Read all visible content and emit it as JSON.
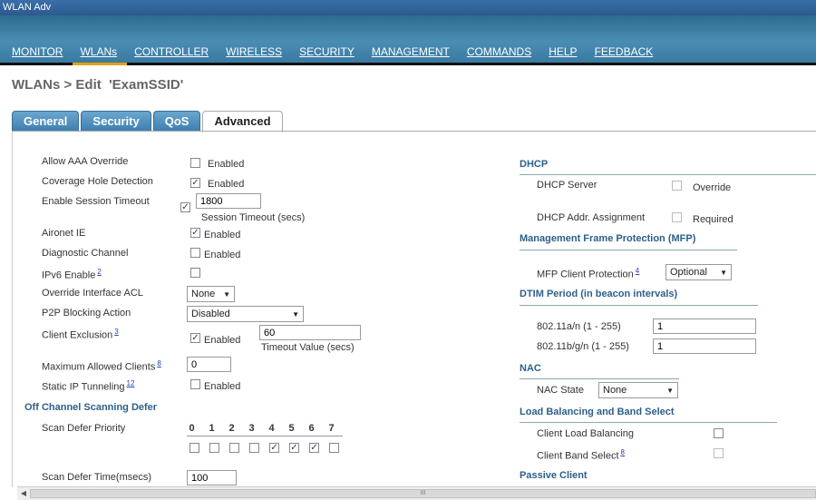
{
  "window": {
    "title": "WLAN Adv"
  },
  "menu": [
    {
      "label": "MONITOR"
    },
    {
      "label": "WLANs"
    },
    {
      "label": "CONTROLLER"
    },
    {
      "label": "WIRELESS"
    },
    {
      "label": "SECURITY"
    },
    {
      "label": "MANAGEMENT"
    },
    {
      "label": "COMMANDS"
    },
    {
      "label": "HELP"
    },
    {
      "label": "FEEDBACK"
    }
  ],
  "page": {
    "title": "WLANs > Edit  'ExamSSID'"
  },
  "tabs": [
    {
      "label": "General"
    },
    {
      "label": "Security"
    },
    {
      "label": "QoS"
    },
    {
      "label": "Advanced"
    }
  ],
  "left": {
    "allow_aaa": {
      "label": "Allow AAA Override",
      "cb": "Enabled",
      "checked": false
    },
    "coverage_hole": {
      "label": "Coverage Hole Detection",
      "cb": "Enabled",
      "checked": true
    },
    "session_timeout": {
      "label": "Enable Session Timeout",
      "checked": true,
      "value": "1800",
      "caption": "Session Timeout (secs)"
    },
    "aironet_ie": {
      "label": "Aironet IE",
      "cb": "Enabled",
      "checked": true
    },
    "diag_channel": {
      "label": "Diagnostic Channel",
      "cb": "Enabled",
      "checked": false
    },
    "ipv6": {
      "label": "IPv6 Enable",
      "sup": "2",
      "checked": false
    },
    "override_acl": {
      "label": "Override Interface ACL",
      "value": "None"
    },
    "p2p": {
      "label": "P2P Blocking Action",
      "value": "Disabled"
    },
    "client_exclusion": {
      "label": "Client Exclusion",
      "sup": "3",
      "cb": "Enabled",
      "checked": true,
      "value": "60",
      "caption": "Timeout Value (secs)"
    },
    "max_clients": {
      "label": "Maximum Allowed Clients",
      "sup": "8",
      "value": "0"
    },
    "static_ip": {
      "label": "Static IP Tunneling",
      "sup": "12",
      "cb": "Enabled",
      "checked": false
    },
    "off_channel": {
      "title": "Off Channel Scanning Defer"
    },
    "scan_priority": {
      "label": "Scan Defer Priority",
      "numbers": [
        "0",
        "1",
        "2",
        "3",
        "4",
        "5",
        "6",
        "7"
      ],
      "checked": [
        false,
        false,
        false,
        false,
        true,
        true,
        true,
        false
      ]
    },
    "scan_time": {
      "label": "Scan Defer Time(msecs)",
      "value": "100"
    }
  },
  "right": {
    "dhcp": {
      "title": "DHCP"
    },
    "dhcp_server": {
      "label": "DHCP Server",
      "cb": "Override",
      "checked": false
    },
    "dhcp_assign": {
      "label": "DHCP Addr. Assignment",
      "cb": "Required",
      "checked": false
    },
    "mfp": {
      "title": "Management Frame Protection (MFP)"
    },
    "mfp_client": {
      "label": "MFP Client Protection",
      "sup": "4",
      "value": "Optional"
    },
    "dtim": {
      "title": "DTIM Period (in beacon intervals)"
    },
    "dtim_a": {
      "label": "802.11a/n (1 - 255)",
      "value": "1"
    },
    "dtim_b": {
      "label": "802.11b/g/n (1 - 255)",
      "value": "1"
    },
    "nac": {
      "title": "NAC"
    },
    "nac_state": {
      "label": "NAC State",
      "value": "None"
    },
    "lb": {
      "title": "Load Balancing and Band Select"
    },
    "client_lb": {
      "label": "Client Load Balancing",
      "checked": false
    },
    "client_bs": {
      "label": "Client Band Select",
      "sup": "8",
      "checked": false
    },
    "passive": {
      "title": "Passive Client"
    }
  },
  "glyphs": {
    "check": "✓",
    "arrow": "▼",
    "scroll_left": "◀",
    "thumb": "III"
  }
}
